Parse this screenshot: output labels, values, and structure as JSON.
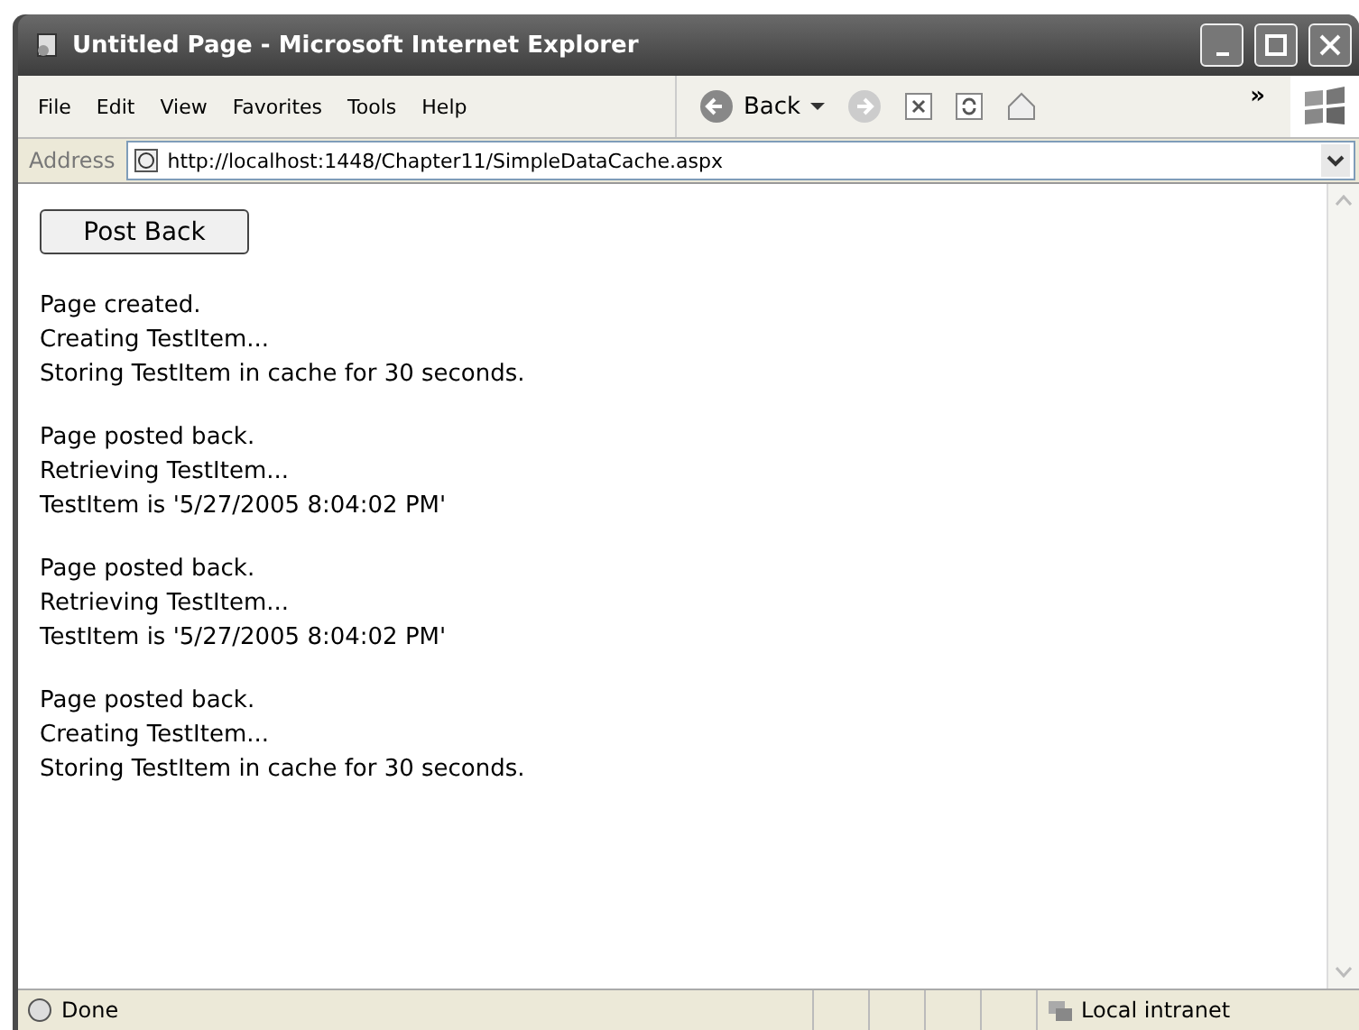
{
  "window": {
    "title": "Untitled Page - Microsoft Internet Explorer"
  },
  "menu": [
    "File",
    "Edit",
    "View",
    "Favorites",
    "Tools",
    "Help"
  ],
  "toolbar": {
    "back_label": "Back",
    "chevron": "»"
  },
  "address": {
    "label": "Address",
    "value": "http://localhost:1448/Chapter11/SimpleDataCache.aspx"
  },
  "page": {
    "button": "Post Back",
    "blocks": [
      [
        "Page created.",
        "Creating TestItem...",
        "Storing TestItem in cache for 30 seconds."
      ],
      [
        "Page posted back.",
        "Retrieving TestItem...",
        "TestItem is '5/27/2005 8:04:02 PM'"
      ],
      [
        "Page posted back.",
        "Retrieving TestItem...",
        "TestItem is '5/27/2005 8:04:02 PM'"
      ],
      [
        "Page posted back.",
        "Creating TestItem...",
        "Storing TestItem in cache for 30 seconds."
      ]
    ]
  },
  "status_bar": {
    "text": "Done",
    "zone": "Local intranet"
  }
}
